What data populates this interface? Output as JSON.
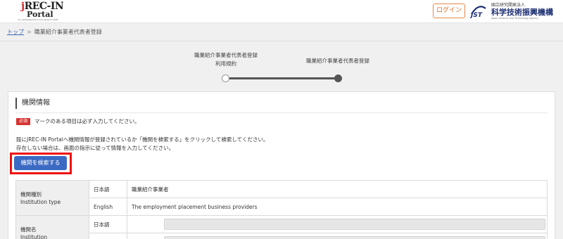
{
  "header": {
    "logo": {
      "top": "REC-IN",
      "top_accent": "j",
      "bottom": "Portal",
      "tagline": "for all Researchers and research staff"
    },
    "login_label": "ログイン",
    "jst": {
      "mark": "JST",
      "small": "国立研究開発法人",
      "main": "科学技術振興機構",
      "english": "Japan Science and Technology Agency"
    }
  },
  "breadcrumb": {
    "home": "トップ",
    "separator": ">",
    "current": "職業紹介事業者代表者登録"
  },
  "steps": [
    {
      "line1": "職業紹介事業者代表者登録",
      "line2": "利用規約",
      "state": "done"
    },
    {
      "line1": "職業紹介事業者代表者登録",
      "state": "current"
    }
  ],
  "section": {
    "title": "機関情報",
    "required_badge": "必須",
    "required_note": "マークのある項目は必ず入力してください。",
    "info_line1": "既にJREC-IN Portalへ機関情報が登録されているか「機関を検索する」をクリックして検索してください。",
    "info_line2": "存在しない場合は、画面の指示に従って情報を入力してください。",
    "search_button": "機関を検索する"
  },
  "table": {
    "rows": [
      {
        "label_ja": "機関種別",
        "label_en": "Institution type",
        "ja_lang": "日本語",
        "ja_value": "職業紹介事業者",
        "en_lang": "English",
        "en_value": "The employment placement business providers"
      },
      {
        "label_ja": "機関名",
        "label_en": "Institution",
        "ja_lang": "日本語",
        "ja_value": "",
        "en_lang": "",
        "en_value": ""
      }
    ]
  },
  "colors": {
    "accent": "#3b6ac4",
    "highlight_frame": "#ee1010",
    "required": "#d53330",
    "login": "#e06a1f"
  }
}
